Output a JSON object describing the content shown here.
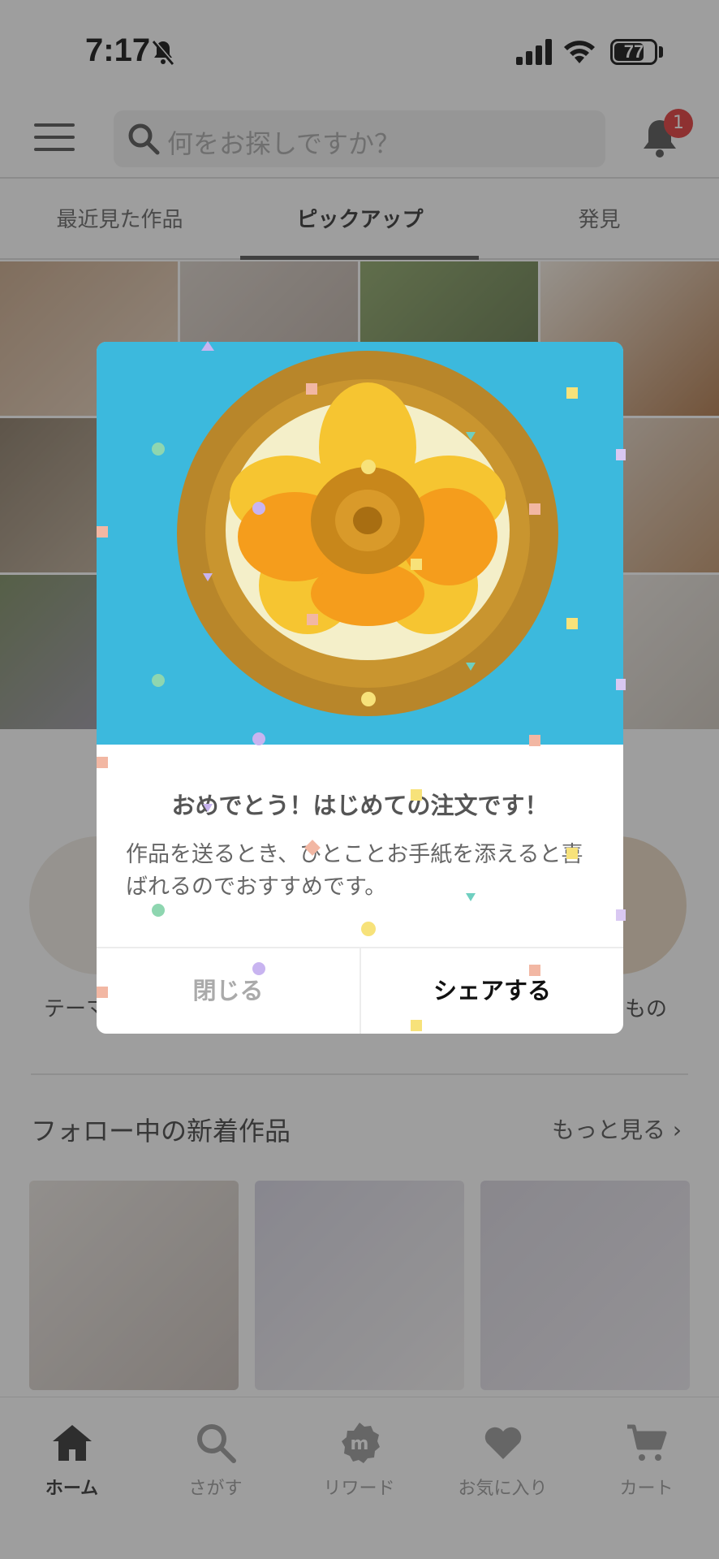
{
  "status_bar": {
    "time": "7:17",
    "battery": "77",
    "battery_level": 0.77
  },
  "header": {
    "search_placeholder": "何をお探しですか？",
    "notification_count": "1"
  },
  "tabs": [
    {
      "label": "最近見た作品"
    },
    {
      "label": "ピックアップ"
    },
    {
      "label": "発見"
    }
  ],
  "theme_row": {
    "left_label": "テーマ",
    "right_label": "もの"
  },
  "following": {
    "title": "フォロー中の新着作品",
    "more": "もっと見る ›"
  },
  "bottom_nav": [
    {
      "label": "ホーム",
      "icon": "home-icon"
    },
    {
      "label": "さがす",
      "icon": "search-icon"
    },
    {
      "label": "リワード",
      "icon": "reward-icon"
    },
    {
      "label": "お気に入り",
      "icon": "heart-icon"
    },
    {
      "label": "カート",
      "icon": "cart-icon"
    }
  ],
  "dialog": {
    "title": "おめでとう！はじめての注文です！",
    "body": "作品を送るとき、ひとことお手紙を添えると喜ばれるのでおすすめです。",
    "close_label": "閉じる",
    "share_label": "シェアする"
  },
  "colors": {
    "overlay": "#282828",
    "badge": "#e23a3a",
    "image_background": "#3cb9dd"
  }
}
